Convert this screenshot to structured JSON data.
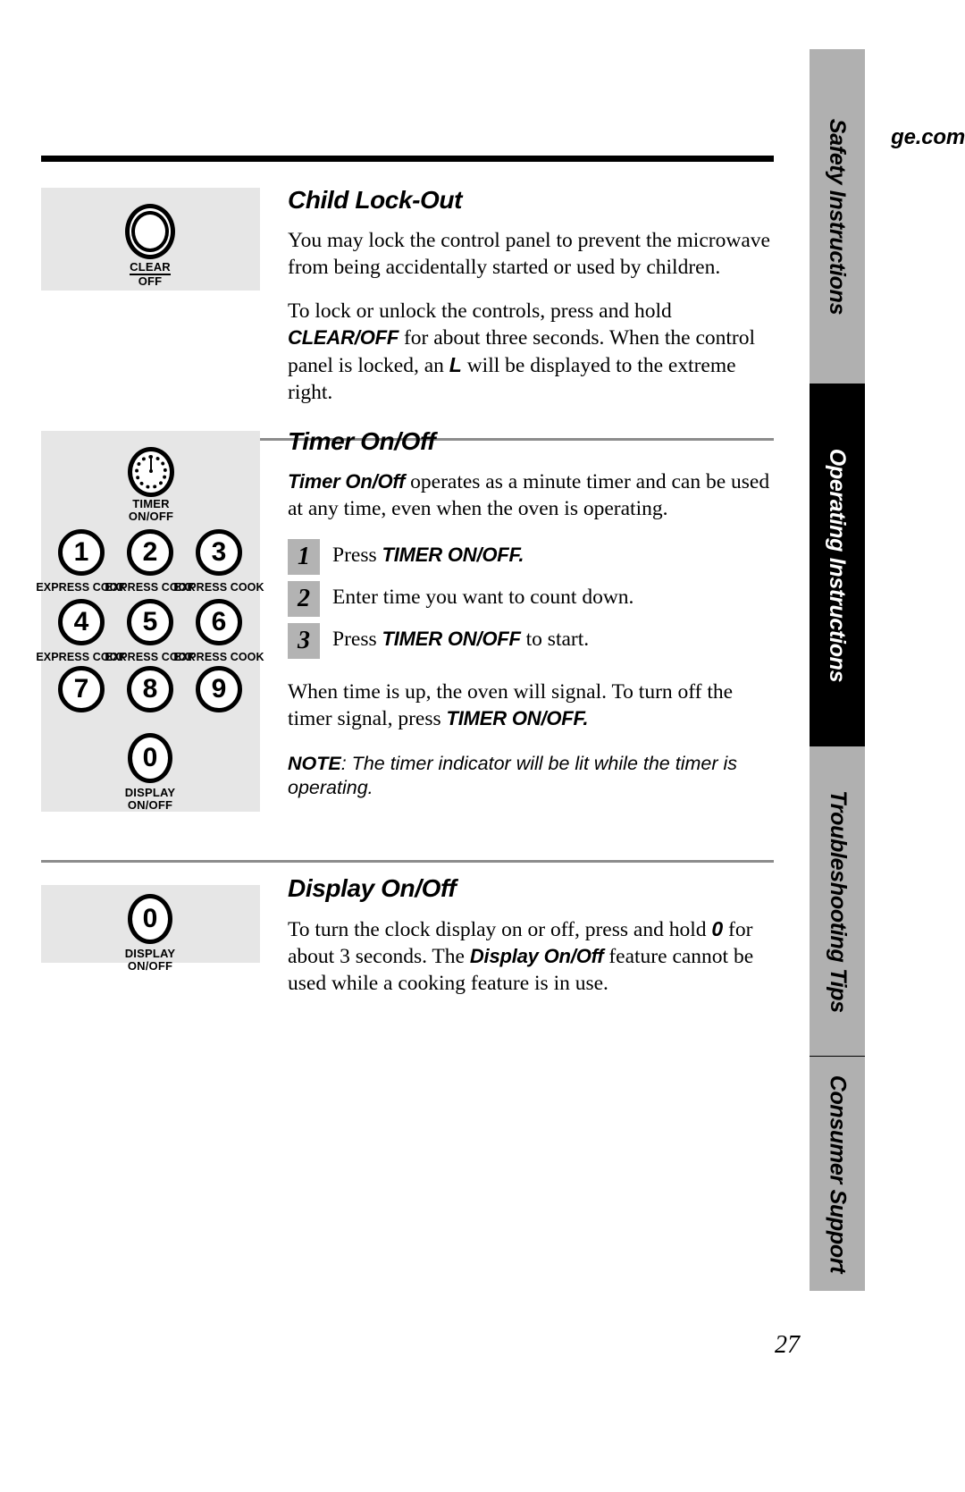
{
  "header": {
    "site": "ge.com"
  },
  "folio": {
    "page_number": "27"
  },
  "tabs": [
    {
      "label": "Safety Instructions",
      "active": false
    },
    {
      "label": "Operating Instructions",
      "active": true
    },
    {
      "label": "Troubleshooting Tips",
      "active": false
    },
    {
      "label": "Consumer Support",
      "active": false
    }
  ],
  "sections": [
    {
      "id": "child-lock-out",
      "title": "Child Lock-Out",
      "paragraphs": [
        "You may lock the control panel to prevent the microwave from being accidentally started or used by children.",
        "To lock or unlock the controls, press and hold CLEAR/OFF for about three seconds. When the control panel is locked, an L will be displayed to the extreme right."
      ],
      "p1": "You may lock the control panel to prevent the microwave from being accidentally started or used by children.",
      "p2a": "To lock or unlock the controls, press and hold ",
      "p2b": "CLEAR/OFF",
      "p2c": " for about three seconds. When the control panel is locked, an ",
      "p2d": "L",
      "p2e": " will be displayed to the extreme right.",
      "art": {
        "clear_label": "CLEAR",
        "off_label": "OFF"
      }
    },
    {
      "id": "timer-on-off",
      "title": "Timer On/Off",
      "intro_bold": "Timer On/Off",
      "intro_rest": "  operates as a minute timer and can be used at any time, even when the oven is operating.",
      "steps": [
        {
          "num": "1",
          "pre": "Press ",
          "key": "TIMER ON/OFF.",
          "post": ""
        },
        {
          "num": "2",
          "pre": "Enter time you want to count down.",
          "key": "",
          "post": ""
        },
        {
          "num": "3",
          "pre": "Press ",
          "key": "TIMER ON/OFF",
          "post": " to start."
        }
      ],
      "outro_pre": "When time is up, the oven will signal. To turn off the timer signal, press ",
      "outro_key": "TIMER ON/OFF.",
      "note_label": "NOTE",
      "note_text": ": The timer indicator will be lit while the timer is operating.",
      "art": {
        "timer_caption_line1": "TIMER",
        "timer_caption_line2": "ON/OFF",
        "keys": [
          {
            "digit": "1",
            "sub": "EXPRESS COOK"
          },
          {
            "digit": "2",
            "sub": "EXPRESS COOK"
          },
          {
            "digit": "3",
            "sub": "EXPRESS COOK"
          },
          {
            "digit": "4",
            "sub": "EXPRESS COOK"
          },
          {
            "digit": "5",
            "sub": "EXPRESS COOK"
          },
          {
            "digit": "6",
            "sub": "EXPRESS COOK"
          },
          {
            "digit": "7",
            "sub": ""
          },
          {
            "digit": "8",
            "sub": ""
          },
          {
            "digit": "9",
            "sub": ""
          }
        ],
        "zero_digit": "0",
        "zero_caption_line1": "DISPLAY",
        "zero_caption_line2": "ON/OFF"
      }
    },
    {
      "id": "display-on-off",
      "title": "Display On/Off",
      "p_a": "To turn the clock display on or off, press and hold ",
      "p_b": "0",
      "p_c": " for about 3 seconds. The ",
      "p_d": "Display On/Off",
      "p_e": " feature cannot be used while a cooking feature is in use.",
      "art": {
        "zero_digit": "0",
        "caption_line1": "DISPLAY",
        "caption_line2": "ON/OFF"
      }
    }
  ],
  "colors": {
    "art_background": "#e6e6e6",
    "step_box": "#b3b3b3",
    "tab_inactive": "#b0b0b0",
    "tab_active": "#000000",
    "rule": "#8c8c8c"
  }
}
